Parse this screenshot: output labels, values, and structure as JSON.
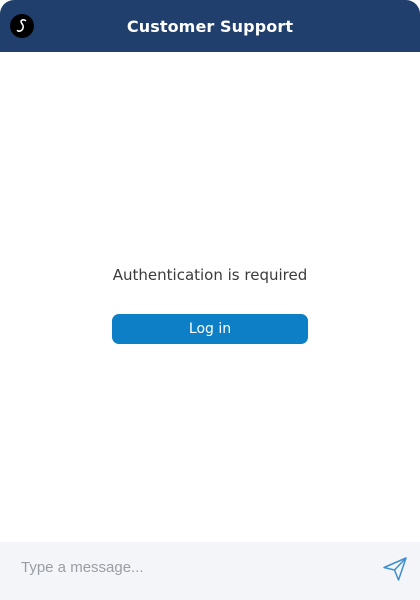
{
  "header": {
    "title": "Customer Support",
    "logo_icon": "s-logo-icon"
  },
  "main": {
    "auth_message": "Authentication is required",
    "login_label": "Log in"
  },
  "composer": {
    "placeholder": "Type a message...",
    "value": "",
    "send_icon": "paper-plane-icon"
  },
  "colors": {
    "header_bg": "#213f6d",
    "button_bg": "#0d7fc6",
    "footer_bg": "#f3f5f8",
    "send_icon": "#3e8fd0"
  }
}
